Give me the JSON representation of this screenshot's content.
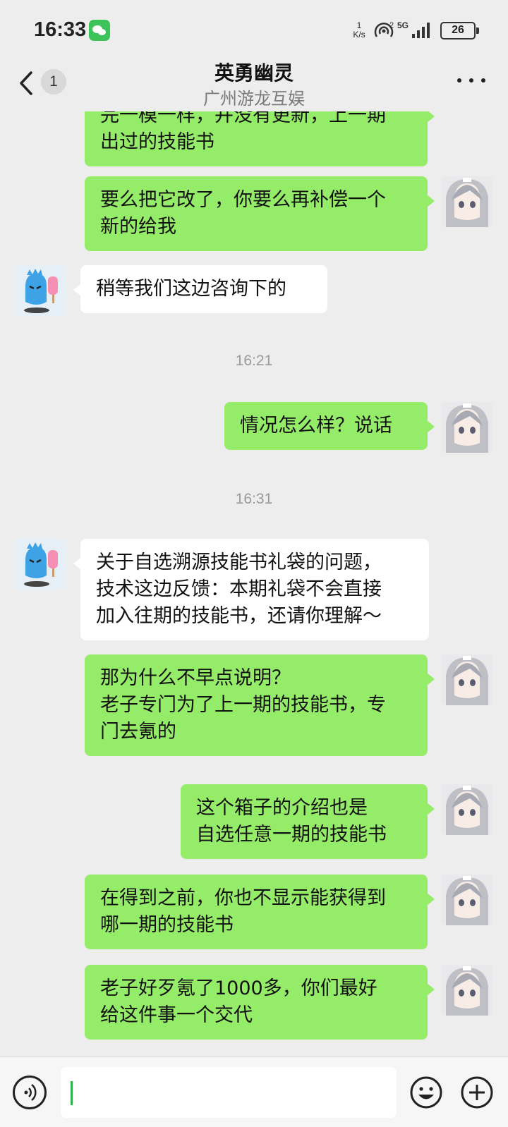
{
  "status_bar": {
    "time": "16:33",
    "net_speed_value": "1",
    "net_speed_unit": "K/s",
    "battery": "26"
  },
  "header": {
    "title": "英勇幽灵",
    "subtitle": "广州游龙互娱",
    "unread_count": "1"
  },
  "messages": [
    {
      "from": "me",
      "text": "完一模一样，并没有更新，上一期\n出过的技能书"
    },
    {
      "from": "me",
      "text": "要么把它改了，你要么再补偿一个\n新的给我"
    },
    {
      "from": "them",
      "text": "稍等我们这边咨询下的"
    },
    {
      "timestamp": "16:21"
    },
    {
      "from": "me",
      "text": "情况怎么样？说话"
    },
    {
      "timestamp": "16:31"
    },
    {
      "from": "them",
      "text": "关于自选溯源技能书礼袋的问题，\n技术这边反馈：本期礼袋不会直接\n加入往期的技能书，还请你理解～"
    },
    {
      "from": "me",
      "text": "那为什么不早点说明？\n老子专门为了上一期的技能书，专\n门去氪的"
    },
    {
      "from": "me",
      "text": "这个箱子的介绍也是\n自选任意一期的技能书"
    },
    {
      "from": "me",
      "text": "在得到之前，你也不显示能获得到\n哪一期的技能书"
    },
    {
      "from": "me",
      "text": "老子好歹氪了1000多，你们最好\n给这件事一个交代"
    }
  ],
  "colors": {
    "my_bubble": "#95ec69",
    "their_bubble": "#ffffff",
    "background": "#ededed",
    "caret": "#2bb24c"
  },
  "icons": [
    "back-chevron-icon",
    "more-icon",
    "voice-icon",
    "emoji-icon",
    "plus-icon",
    "wechat-icon",
    "hotspot-icon",
    "signal-icon"
  ]
}
